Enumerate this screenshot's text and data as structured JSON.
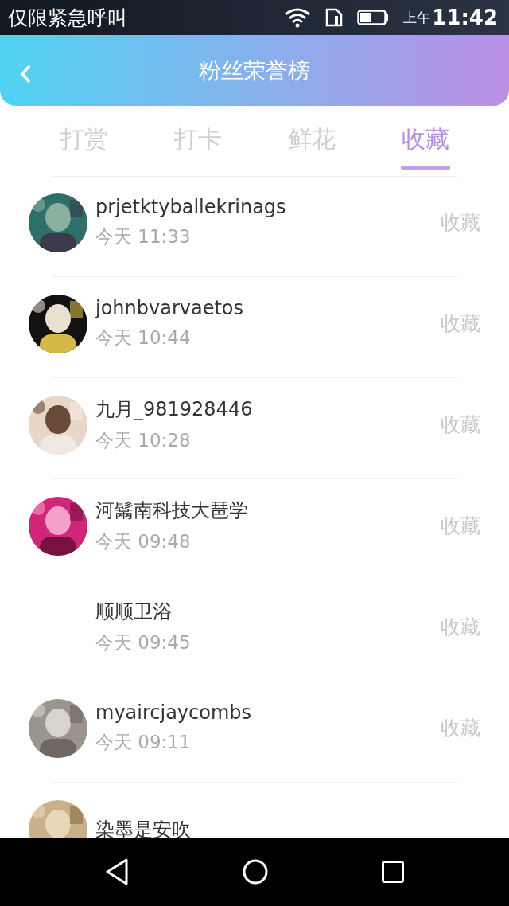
{
  "status_bar": {
    "carrier": "仅限紧急呼叫",
    "ampm": "上午",
    "time": "11:42"
  },
  "header": {
    "title": "粉丝荣誉榜"
  },
  "tabs": [
    {
      "label": "打赏",
      "selected": false
    },
    {
      "label": "打卡",
      "selected": false
    },
    {
      "label": "鲜花",
      "selected": false
    },
    {
      "label": "收藏",
      "selected": true
    }
  ],
  "rows": [
    {
      "name": "prjetktyballekrinags",
      "time": "今天 11:33",
      "action": "收藏"
    },
    {
      "name": "johnbvarvaetos",
      "time": "今天 10:44",
      "action": "收藏"
    },
    {
      "name": "九月_981928446",
      "time": "今天 10:28",
      "action": "收藏"
    },
    {
      "name": "河鬗南科技大琶学",
      "time": "今天 09:48",
      "action": "收藏"
    },
    {
      "name": "顺顺卫浴",
      "time": "今天 09:45",
      "action": "收藏"
    },
    {
      "name": "myaircjaycombs",
      "time": "今天 09:11",
      "action": "收藏"
    },
    {
      "name": "染墨是安吹"
    }
  ]
}
